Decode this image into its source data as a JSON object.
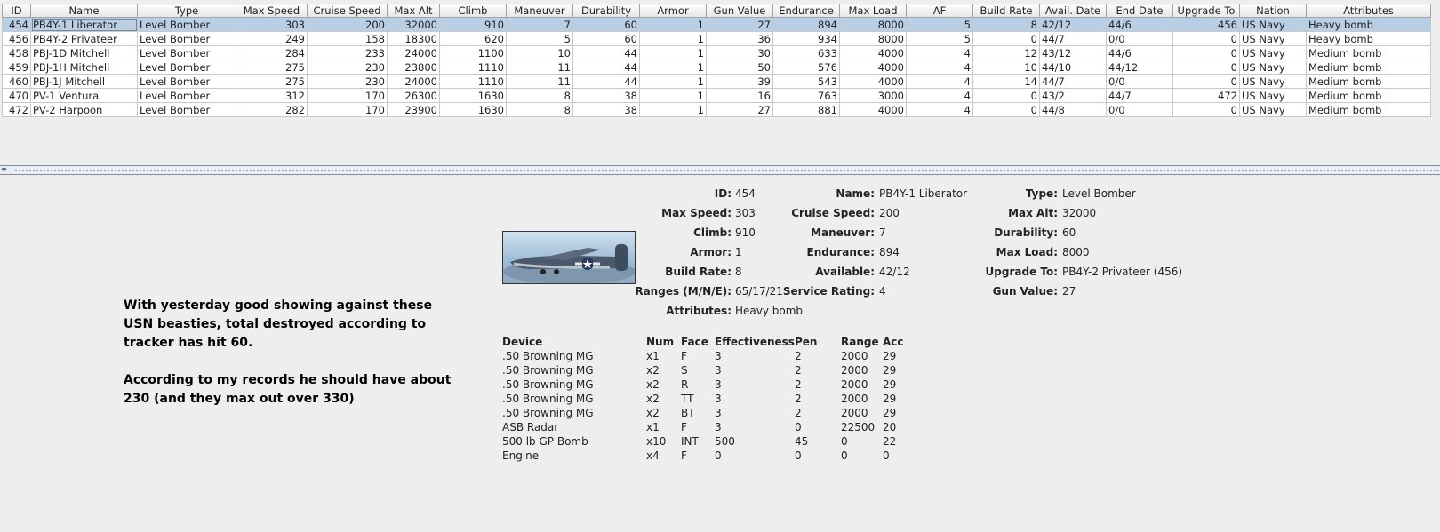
{
  "table": {
    "columns": [
      "ID",
      "Name",
      "Type",
      "Max Speed",
      "Cruise Speed",
      "Max Alt",
      "Climb",
      "Maneuver",
      "Durability",
      "Armor",
      "Gun Value",
      "Endurance",
      "Max Load",
      "AF",
      "Build Rate",
      "Avail. Date",
      "End Date",
      "Upgrade To",
      "Nation",
      "Attributes"
    ],
    "rows": [
      [
        "454",
        "PB4Y-1 Liberator",
        "Level Bomber",
        "303",
        "200",
        "32000",
        "910",
        "7",
        "60",
        "1",
        "27",
        "894",
        "8000",
        "5",
        "8",
        "42/12",
        "44/6",
        "456",
        "US Navy",
        "Heavy bomb"
      ],
      [
        "456",
        "PB4Y-2 Privateer",
        "Level Bomber",
        "249",
        "158",
        "18300",
        "620",
        "5",
        "60",
        "1",
        "36",
        "934",
        "8000",
        "5",
        "0",
        "44/7",
        "0/0",
        "0",
        "US Navy",
        "Heavy bomb"
      ],
      [
        "458",
        "PBJ-1D Mitchell",
        "Level Bomber",
        "284",
        "233",
        "24000",
        "1100",
        "10",
        "44",
        "1",
        "30",
        "633",
        "4000",
        "4",
        "12",
        "43/12",
        "44/6",
        "0",
        "US Navy",
        "Medium bomb"
      ],
      [
        "459",
        "PBJ-1H Mitchell",
        "Level Bomber",
        "275",
        "230",
        "23800",
        "1110",
        "11",
        "44",
        "1",
        "50",
        "576",
        "4000",
        "4",
        "10",
        "44/10",
        "44/12",
        "0",
        "US Navy",
        "Medium bomb"
      ],
      [
        "460",
        "PBJ-1J Mitchell",
        "Level Bomber",
        "275",
        "230",
        "24000",
        "1110",
        "11",
        "44",
        "1",
        "39",
        "543",
        "4000",
        "4",
        "14",
        "44/7",
        "0/0",
        "0",
        "US Navy",
        "Medium bomb"
      ],
      [
        "470",
        "PV-1 Ventura",
        "Level Bomber",
        "312",
        "170",
        "26300",
        "1630",
        "8",
        "38",
        "1",
        "16",
        "763",
        "3000",
        "4",
        "0",
        "43/2",
        "44/7",
        "472",
        "US Navy",
        "Medium bomb"
      ],
      [
        "472",
        "PV-2 Harpoon",
        "Level Bomber",
        "282",
        "170",
        "23900",
        "1630",
        "8",
        "38",
        "1",
        "27",
        "881",
        "4000",
        "4",
        "0",
        "44/8",
        "0/0",
        "0",
        "US Navy",
        "Medium bomb"
      ]
    ],
    "selected_row": 0
  },
  "note": {
    "para1": "With yesterday good showing against these USN beasties, total destroyed according to tracker has hit 60.",
    "para2": "According to my records he should have about 230 (and they max out over 330)"
  },
  "detail": {
    "id_label": "ID:",
    "id": "454",
    "name_label": "Name:",
    "name": "PB4Y-1 Liberator",
    "type_label": "Type:",
    "type": "Level Bomber",
    "max_speed_label": "Max Speed:",
    "max_speed": "303",
    "cruise_speed_label": "Cruise Speed:",
    "cruise_speed": "200",
    "max_alt_label": "Max Alt:",
    "max_alt": "32000",
    "climb_label": "Climb:",
    "climb": "910",
    "maneuver_label": "Maneuver:",
    "maneuver": "7",
    "durability_label": "Durability:",
    "durability": "60",
    "armor_label": "Armor:",
    "armor": "1",
    "endurance_label": "Endurance:",
    "endurance": "894",
    "max_load_label": "Max Load:",
    "max_load": "8000",
    "build_rate_label": "Build Rate:",
    "build_rate": "8",
    "available_label": "Available:",
    "available": "42/12",
    "upgrade_to_label": "Upgrade To:",
    "upgrade_to": "PB4Y-2 Privateer (456)",
    "ranges_label": "Ranges (M/N/E):",
    "ranges": "65/17/21",
    "service_rating_label": "Service Rating:",
    "service_rating": "4",
    "gun_value_label": "Gun Value:",
    "gun_value": "27",
    "attributes_label": "Attributes:",
    "attributes": "Heavy bomb"
  },
  "devices": {
    "headers": [
      "Device",
      "Num",
      "Face",
      "Effectiveness",
      "Pen",
      "Range",
      "Acc"
    ],
    "rows": [
      [
        ".50 Browning MG",
        "x1",
        "F",
        "3",
        "2",
        "2000",
        "29"
      ],
      [
        ".50 Browning MG",
        "x2",
        "S",
        "3",
        "2",
        "2000",
        "29"
      ],
      [
        ".50 Browning MG",
        "x2",
        "R",
        "3",
        "2",
        "2000",
        "29"
      ],
      [
        ".50 Browning MG",
        "x2",
        "TT",
        "3",
        "2",
        "2000",
        "29"
      ],
      [
        ".50 Browning MG",
        "x2",
        "BT",
        "3",
        "2",
        "2000",
        "29"
      ],
      [
        "ASB Radar",
        "x1",
        "F",
        "3",
        "0",
        "22500",
        "20"
      ],
      [
        "500 lb GP Bomb",
        "x10",
        "INT",
        "500",
        "45",
        "0",
        "22"
      ],
      [
        "Engine",
        "x4",
        "F",
        "0",
        "0",
        "0",
        "0"
      ]
    ]
  },
  "icons": {
    "divider_arrows": "split-collapse-arrows-icon",
    "aircraft": "aircraft-photo"
  }
}
